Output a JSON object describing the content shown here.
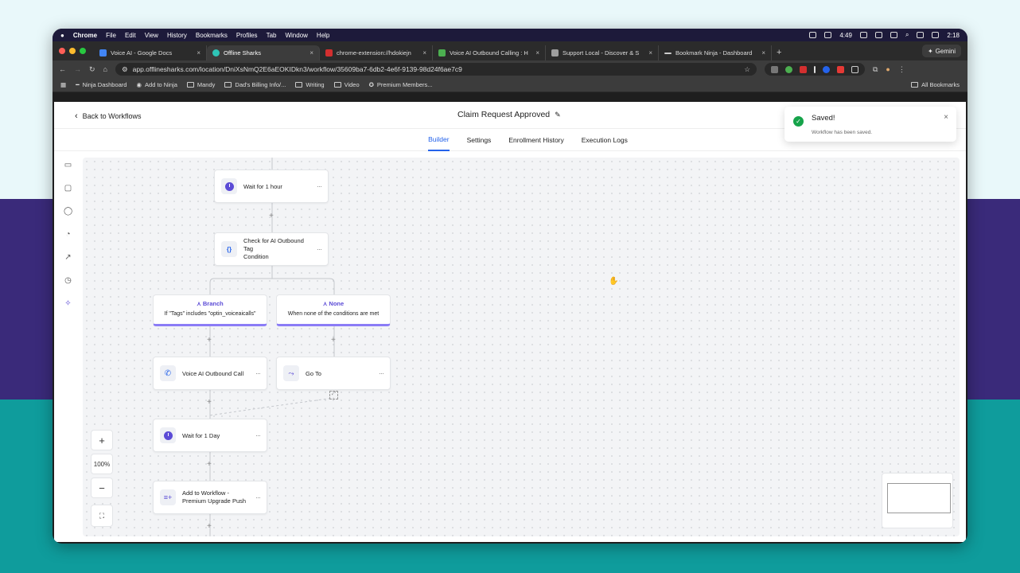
{
  "mac_menu": {
    "app": "Chrome",
    "items": [
      "File",
      "Edit",
      "View",
      "History",
      "Bookmarks",
      "Profiles",
      "Tab",
      "Window",
      "Help"
    ],
    "battery_time": "4:49",
    "clock": "2:18"
  },
  "tabs": [
    {
      "label": "Voice AI - Google Docs",
      "color": "#4285f4"
    },
    {
      "label": "Offline Sharks",
      "color": "#2ec4b6",
      "active": true
    },
    {
      "label": "chrome-extension://hdokiejn",
      "color": "#d32f2f"
    },
    {
      "label": "Voice AI Outbound Calling : H",
      "color": "#4caf50"
    },
    {
      "label": "Support Local - Discover & S",
      "color": "#9e9e9e"
    },
    {
      "label": "Bookmark Ninja - Dashboard",
      "color": "#cccccc"
    }
  ],
  "gemini_label": "Gemini",
  "url": "app.offlinesharks.com/location/DniXsNmQ2E6aEOKIDkn3/workflow/35609ba7-6db2-4e6f-9139-98d24f6ae7c9",
  "bookmarks": [
    "Ninja Dashboard",
    "Add to Ninja",
    "Mandy",
    "Dad's Billing Info/...",
    "Writing",
    "Video",
    "Premium Members..."
  ],
  "all_bookmarks": "All Bookmarks",
  "header": {
    "back_label": "Back to Workflows",
    "title": "Claim Request Approved"
  },
  "subnav": [
    "Builder",
    "Settings",
    "Enrollment History",
    "Execution Logs"
  ],
  "nodes": {
    "wait_hour": "Wait for 1 hour",
    "check_tag_line1": "Check for AI Outbound Tag",
    "check_tag_line2": "Condition",
    "branch_title": "Branch",
    "branch_desc": "If \"Tags\" includes \"optin_voiceaicalls\"",
    "none_title": "None",
    "none_desc": "When none of the conditions are met",
    "voice_call": "Voice AI Outbound Call",
    "goto": "Go To",
    "wait_day": "Wait for 1 Day",
    "add_wf_line1": "Add to Workflow -",
    "add_wf_line2": "Premium Upgrade Push"
  },
  "zoom": {
    "plus": "+",
    "level": "100%",
    "minus": "−"
  },
  "toast": {
    "title": "Saved!",
    "message": "Workflow has been saved."
  }
}
